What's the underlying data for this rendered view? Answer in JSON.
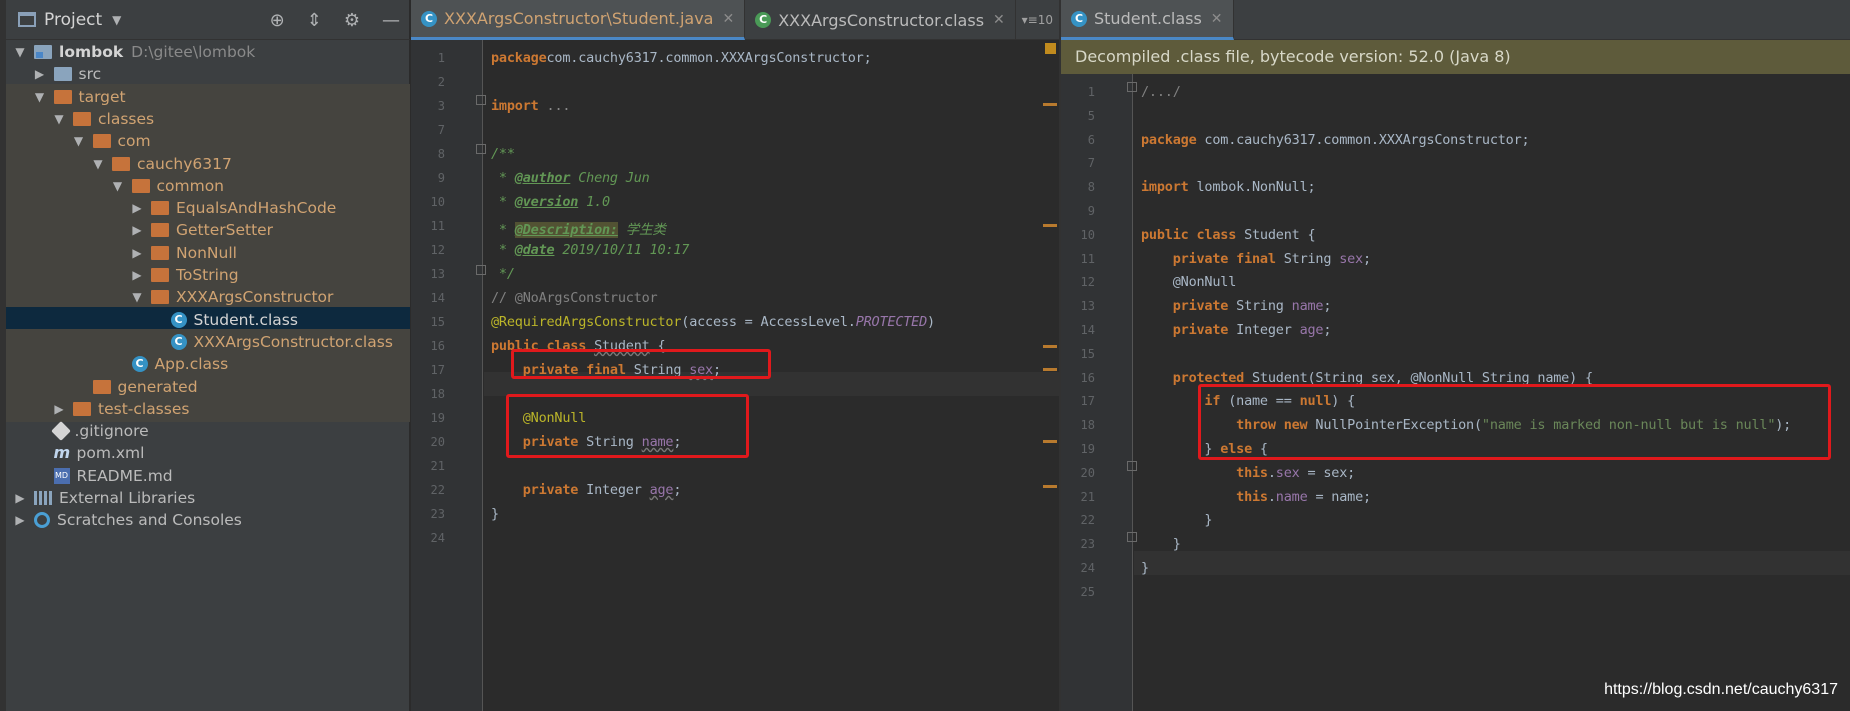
{
  "project": {
    "title": "Project",
    "tree": [
      {
        "label": "lombok",
        "hint": "D:\\gitee\\lombok",
        "depth": 0,
        "expanded": true,
        "icon": "folder-module"
      },
      {
        "label": "src",
        "depth": 1,
        "expanded": false,
        "icon": "folder-blue"
      },
      {
        "label": "target",
        "depth": 1,
        "expanded": true,
        "icon": "folder-orange"
      },
      {
        "label": "classes",
        "depth": 2,
        "expanded": true,
        "icon": "folder-orange"
      },
      {
        "label": "com",
        "depth": 3,
        "expanded": true,
        "icon": "folder-orange"
      },
      {
        "label": "cauchy6317",
        "depth": 4,
        "expanded": true,
        "icon": "folder-orange"
      },
      {
        "label": "common",
        "depth": 5,
        "expanded": true,
        "icon": "folder-orange"
      },
      {
        "label": "EqualsAndHashCode",
        "depth": 6,
        "expanded": false,
        "icon": "folder-orange"
      },
      {
        "label": "GetterSetter",
        "depth": 6,
        "expanded": false,
        "icon": "folder-orange"
      },
      {
        "label": "NonNull",
        "depth": 6,
        "expanded": false,
        "icon": "folder-orange"
      },
      {
        "label": "ToString",
        "depth": 6,
        "expanded": false,
        "icon": "folder-orange"
      },
      {
        "label": "XXXArgsConstructor",
        "depth": 6,
        "expanded": true,
        "icon": "folder-orange"
      },
      {
        "label": "Student.class",
        "depth": 7,
        "leaf": true,
        "icon": "class-ic",
        "selected": true
      },
      {
        "label": "XXXArgsConstructor.class",
        "depth": 7,
        "leaf": true,
        "icon": "class-ic"
      },
      {
        "label": "App.class",
        "depth": 5,
        "leaf": true,
        "icon": "class-ic"
      },
      {
        "label": "generated",
        "depth": 3,
        "leaf": true,
        "icon": "folder-orange"
      },
      {
        "label": "test-classes",
        "depth": 2,
        "expanded": false,
        "icon": "folder-orange"
      },
      {
        "label": ".gitignore",
        "depth": 1,
        "leaf": true,
        "icon": "git-ic",
        "plain": true
      },
      {
        "label": "pom.xml",
        "depth": 1,
        "leaf": true,
        "icon": "maven-ic",
        "plain": true
      },
      {
        "label": "README.md",
        "depth": 1,
        "leaf": true,
        "icon": "md-ic",
        "plain": true
      },
      {
        "label": "External Libraries",
        "depth": 0,
        "expanded": false,
        "icon": "lib-ic",
        "plain": true
      },
      {
        "label": "Scratches and Consoles",
        "depth": 0,
        "expanded": false,
        "icon": "scratch-ic",
        "plain": true
      }
    ]
  },
  "left_editor": {
    "tabs": [
      {
        "label": "XXXArgsConstructor\\Student.java",
        "active": true,
        "modified": true
      },
      {
        "label": "XXXArgsConstructor.class",
        "active": false
      }
    ],
    "tab_overflow": "10",
    "lines": [
      {
        "n": "1",
        "t": [
          [
            "kw",
            "package"
          ],
          [
            "",
            "com.cauchy6317.common.XXXArgsConstructor;"
          ]
        ]
      },
      {
        "n": "2",
        "t": []
      },
      {
        "n": "3",
        "t": [
          [
            "kw",
            "import"
          ],
          [
            "",
            " "
          ],
          [
            "grey",
            "..."
          ]
        ]
      },
      {
        "n": "7",
        "t": []
      },
      {
        "n": "8",
        "t": [
          [
            "jd",
            "/**"
          ]
        ]
      },
      {
        "n": "9",
        "t": [
          [
            "jd",
            " * "
          ],
          [
            "jdt",
            "@author"
          ],
          [
            "jd",
            " Cheng Jun"
          ]
        ]
      },
      {
        "n": "10",
        "t": [
          [
            "jd",
            " * "
          ],
          [
            "jdt",
            "@version"
          ],
          [
            "jd",
            " 1.0"
          ]
        ]
      },
      {
        "n": "11",
        "t": [
          [
            "jd",
            " * "
          ],
          [
            "jdt jdhl",
            "@Description:"
          ],
          [
            "jd",
            " 学生类"
          ]
        ]
      },
      {
        "n": "12",
        "t": [
          [
            "jd",
            " * "
          ],
          [
            "jdt",
            "@date"
          ],
          [
            "jd",
            " 2019/10/11 10:17"
          ]
        ]
      },
      {
        "n": "13",
        "t": [
          [
            "jd",
            " */"
          ]
        ]
      },
      {
        "n": "14",
        "t": [
          [
            "cm",
            "// @NoArgsConstructor"
          ]
        ]
      },
      {
        "n": "15",
        "t": [
          [
            "an",
            "@RequiredArgsConstructor"
          ],
          [
            "",
            "(access = AccessLevel."
          ],
          [
            "cst",
            "PROTECTED"
          ],
          [
            "",
            ")"
          ]
        ]
      },
      {
        "n": "16",
        "t": [
          [
            "kw",
            "public class"
          ],
          [
            "",
            " "
          ],
          [
            "wavy",
            "Student"
          ],
          [
            "",
            " {"
          ]
        ]
      },
      {
        "n": "17",
        "t": [
          [
            "",
            "    "
          ],
          [
            "kw",
            "private final"
          ],
          [
            "",
            " String "
          ],
          [
            "fld wavy",
            "sex"
          ],
          [
            "",
            ";"
          ]
        ]
      },
      {
        "n": "18",
        "t": []
      },
      {
        "n": "19",
        "t": [
          [
            "",
            "    "
          ],
          [
            "an",
            "@NonNull"
          ]
        ]
      },
      {
        "n": "20",
        "t": [
          [
            "",
            "    "
          ],
          [
            "kw",
            "private"
          ],
          [
            "",
            " String "
          ],
          [
            "fld wavy",
            "name"
          ],
          [
            "",
            ";"
          ]
        ]
      },
      {
        "n": "21",
        "t": []
      },
      {
        "n": "22",
        "t": [
          [
            "",
            "    "
          ],
          [
            "kw",
            "private"
          ],
          [
            "",
            " Integer "
          ],
          [
            "fld wavy",
            "age"
          ],
          [
            "",
            ";"
          ]
        ]
      },
      {
        "n": "23",
        "t": [
          [
            "",
            "}"
          ]
        ]
      },
      {
        "n": "24",
        "t": []
      }
    ]
  },
  "right_editor": {
    "tabs": [
      {
        "label": "Student.class",
        "active": true
      }
    ],
    "banner": "Decompiled .class file, bytecode version: 52.0 (Java 8)",
    "lines": [
      {
        "n": "1",
        "t": [
          [
            "cm",
            "/.../"
          ]
        ]
      },
      {
        "n": "5",
        "t": []
      },
      {
        "n": "6",
        "t": [
          [
            "kw",
            "package"
          ],
          [
            "",
            " com.cauchy6317.common.XXXArgsConstructor;"
          ]
        ]
      },
      {
        "n": "7",
        "t": []
      },
      {
        "n": "8",
        "t": [
          [
            "kw",
            "import"
          ],
          [
            "",
            " lombok.NonNull;"
          ]
        ]
      },
      {
        "n": "9",
        "t": []
      },
      {
        "n": "10",
        "t": [
          [
            "kw",
            "public class"
          ],
          [
            "",
            " Student {"
          ]
        ]
      },
      {
        "n": "11",
        "t": [
          [
            "",
            "    "
          ],
          [
            "kw",
            "private final"
          ],
          [
            "",
            " String "
          ],
          [
            "fld",
            "sex"
          ],
          [
            "",
            ";"
          ]
        ]
      },
      {
        "n": "12",
        "t": [
          [
            "",
            "    @NonNull"
          ]
        ]
      },
      {
        "n": "13",
        "t": [
          [
            "",
            "    "
          ],
          [
            "kw",
            "private"
          ],
          [
            "",
            " String "
          ],
          [
            "fld",
            "name"
          ],
          [
            "",
            ";"
          ]
        ]
      },
      {
        "n": "14",
        "t": [
          [
            "",
            "    "
          ],
          [
            "kw",
            "private"
          ],
          [
            "",
            " Integer "
          ],
          [
            "fld",
            "age"
          ],
          [
            "",
            ";"
          ]
        ]
      },
      {
        "n": "15",
        "t": []
      },
      {
        "n": "16",
        "t": [
          [
            "",
            "    "
          ],
          [
            "kw",
            "protected"
          ],
          [
            "",
            " Student(String sex, @NonNull String name) {"
          ]
        ]
      },
      {
        "n": "17",
        "t": [
          [
            "",
            "        "
          ],
          [
            "kw",
            "if"
          ],
          [
            "",
            " (name == "
          ],
          [
            "kw",
            "null"
          ],
          [
            "",
            ") {"
          ]
        ]
      },
      {
        "n": "18",
        "t": [
          [
            "",
            "            "
          ],
          [
            "kw",
            "throw new"
          ],
          [
            "",
            " NullPointerException("
          ],
          [
            "st",
            "\"name is marked non-null but is null\""
          ],
          [
            "",
            ");"
          ]
        ]
      },
      {
        "n": "19",
        "t": [
          [
            "",
            "        } "
          ],
          [
            "kw",
            "else"
          ],
          [
            "",
            " {"
          ]
        ]
      },
      {
        "n": "20",
        "t": [
          [
            "",
            "            "
          ],
          [
            "kw",
            "this"
          ],
          [
            "",
            "."
          ],
          [
            "fld",
            "sex"
          ],
          [
            "",
            " = sex;"
          ]
        ]
      },
      {
        "n": "21",
        "t": [
          [
            "",
            "            "
          ],
          [
            "kw",
            "this"
          ],
          [
            "",
            "."
          ],
          [
            "fld",
            "name"
          ],
          [
            "",
            " = name;"
          ]
        ]
      },
      {
        "n": "22",
        "t": [
          [
            "",
            "        }"
          ]
        ]
      },
      {
        "n": "23",
        "t": [
          [
            "",
            "    }"
          ]
        ]
      },
      {
        "n": "24",
        "t": [
          [
            "",
            "}"
          ]
        ]
      },
      {
        "n": "25",
        "t": []
      }
    ]
  },
  "watermark": "https://blog.csdn.net/cauchy6317"
}
